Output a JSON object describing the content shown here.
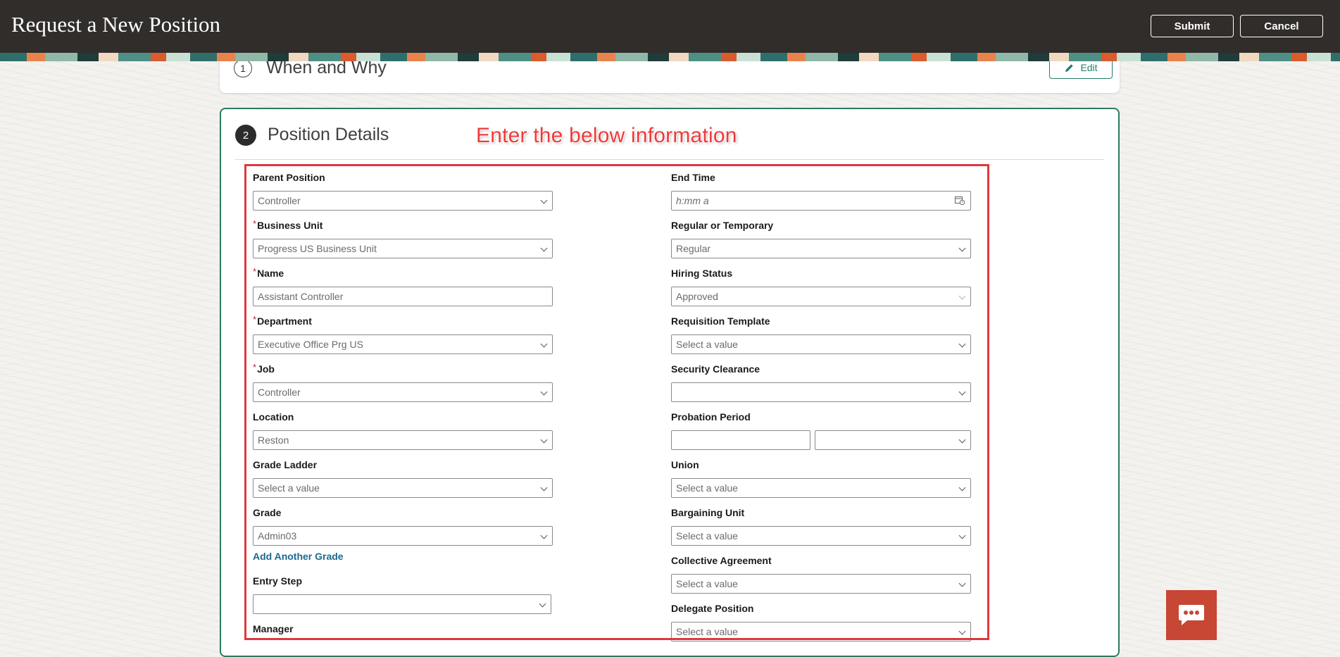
{
  "header": {
    "title": "Request a New Position",
    "submit_label": "Submit",
    "cancel_label": "Cancel"
  },
  "step1": {
    "number": "1",
    "title": "When and Why",
    "edit_label": "Edit"
  },
  "step2": {
    "number": "2",
    "title": "Position Details"
  },
  "annotation": "Enter the below information",
  "left_fields": {
    "parent_position": {
      "label": "Parent Position",
      "value": "Controller"
    },
    "business_unit": {
      "label": "Business Unit",
      "value": "Progress US Business Unit",
      "required": "*"
    },
    "name": {
      "label": "Name",
      "value": "Assistant Controller",
      "required": "*"
    },
    "department": {
      "label": "Department",
      "value": "Executive Office Prg US",
      "required": "*"
    },
    "job": {
      "label": "Job",
      "value": "Controller",
      "required": "*"
    },
    "location": {
      "label": "Location",
      "value": "Reston"
    },
    "grade_ladder": {
      "label": "Grade Ladder",
      "value": "Select a value"
    },
    "grade": {
      "label": "Grade",
      "value": "Admin03"
    },
    "add_grade_link": "Add Another Grade",
    "entry_step": {
      "label": "Entry Step",
      "value": ""
    },
    "manager": {
      "label": "Manager"
    }
  },
  "right_fields": {
    "end_time": {
      "label": "End Time",
      "placeholder": "h:mm a"
    },
    "regular_temporary": {
      "label": "Regular or Temporary",
      "value": "Regular"
    },
    "hiring_status": {
      "label": "Hiring Status",
      "value": "Approved"
    },
    "requisition_template": {
      "label": "Requisition Template",
      "value": "Select a value"
    },
    "security_clearance": {
      "label": "Security Clearance",
      "value": ""
    },
    "probation_period": {
      "label": "Probation Period",
      "value": "",
      "unit": ""
    },
    "union": {
      "label": "Union",
      "value": "Select a value"
    },
    "bargaining_unit": {
      "label": "Bargaining Unit",
      "value": "Select a value"
    },
    "collective_agreement": {
      "label": "Collective Agreement",
      "value": "Select a value"
    },
    "delegate_position": {
      "label": "Delegate Position",
      "value": "Select a value"
    }
  },
  "colors": {
    "header_bg": "#312d2a",
    "card_border": "#2c7a5e",
    "annotation_red": "#ee3a3a",
    "link": "#1b6a8f",
    "chat_bg": "#c74634"
  },
  "icons": {
    "edit": "pencil-icon",
    "calendar": "calendar-clock-icon",
    "chevron": "chevron-down-icon",
    "chat": "chat-bubble-icon"
  }
}
